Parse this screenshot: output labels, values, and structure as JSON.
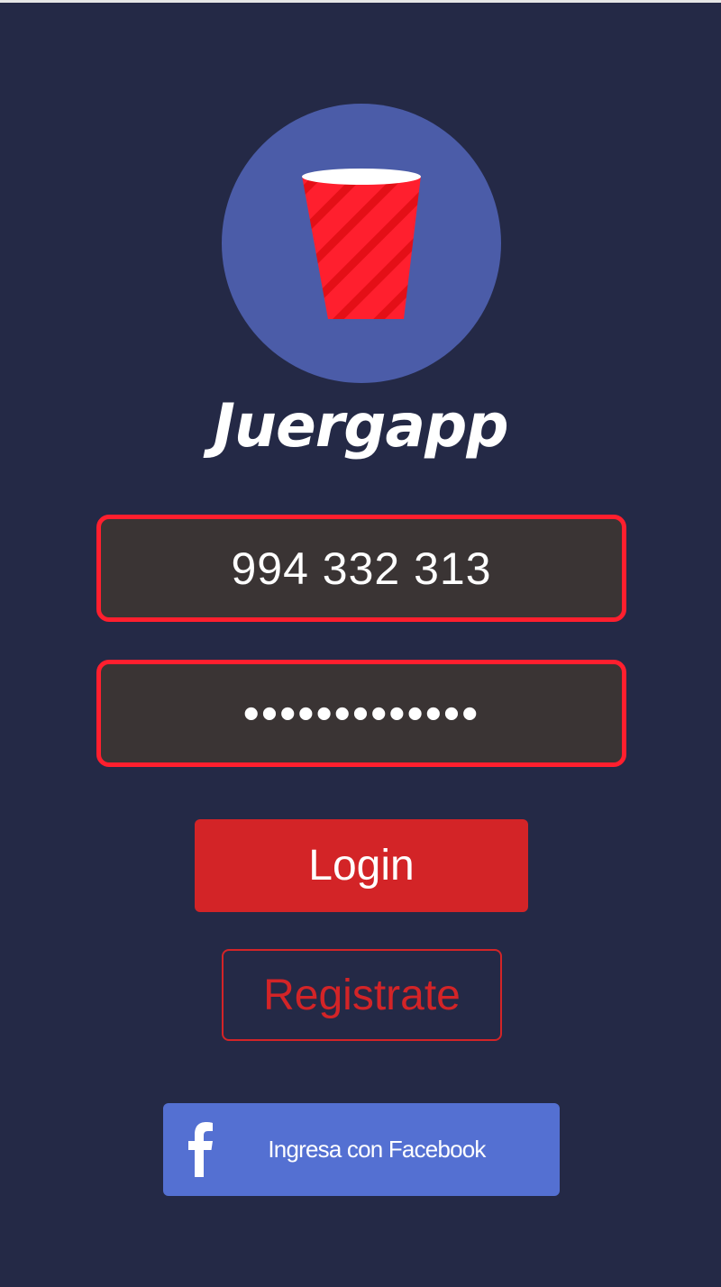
{
  "app": {
    "title": "Juergapp",
    "logo_icon": "red-party-cup-icon"
  },
  "login_form": {
    "phone_value": "994 332 313",
    "password_value": "•••••••••••••",
    "login_label": "Login",
    "register_label": "Registrate",
    "facebook_label": "Ingresa con Facebook",
    "facebook_icon": "facebook-f-icon"
  },
  "colors": {
    "background": "#242946",
    "logo_circle": "#4b5ca8",
    "input_border": "#ff1f2e",
    "input_fill": "#3a3434",
    "primary_red": "#d32427",
    "facebook_blue": "#5470d2"
  }
}
